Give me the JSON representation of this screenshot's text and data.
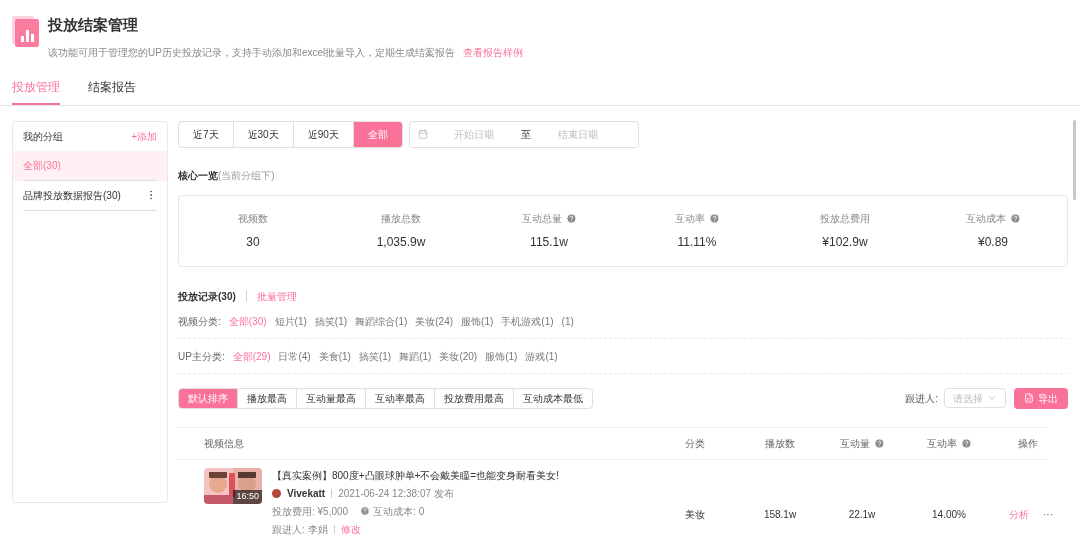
{
  "header": {
    "title": "投放结案管理",
    "description": "该功能可用于管理您的UP历史投放记录，支持手动添加和excel批量导入，定期生成结案报告",
    "link": "查看报告样例"
  },
  "tabs": [
    {
      "label": "投放管理",
      "selected": true
    },
    {
      "label": "结案报告",
      "selected": false
    }
  ],
  "sidebar": {
    "title": "我的分组",
    "add": "+添加",
    "groups": [
      {
        "label": "全部(30)",
        "selected": true,
        "has_menu": false
      },
      {
        "label": "品牌投放数据报告(30)",
        "selected": false,
        "has_menu": true
      }
    ]
  },
  "date_filter": {
    "ranges": [
      {
        "label": "近7天",
        "selected": false
      },
      {
        "label": "近30天",
        "selected": false
      },
      {
        "label": "近90天",
        "selected": false
      },
      {
        "label": "全部",
        "selected": true
      }
    ],
    "start_placeholder": "开始日期",
    "separator": "至",
    "end_placeholder": "结束日期"
  },
  "overview": {
    "title": "核心一览",
    "note": "(当前分组下)",
    "metrics": [
      {
        "label": "视频数",
        "value": "30",
        "help": false
      },
      {
        "label": "播放总数",
        "value": "1,035.9w",
        "help": false
      },
      {
        "label": "互动总量",
        "value": "115.1w",
        "help": true
      },
      {
        "label": "互动率",
        "value": "11.11%",
        "help": true
      },
      {
        "label": "投放总费用",
        "value": "¥102.9w",
        "help": false
      },
      {
        "label": "互动成本",
        "value": "¥0.89",
        "help": true
      }
    ]
  },
  "records": {
    "title": "投放记录(30)",
    "batch": "批量管理",
    "filters": [
      {
        "label": "视频分类:",
        "options": [
          {
            "label": "全部(30)",
            "selected": true
          },
          {
            "label": "短片(1)",
            "selected": false
          },
          {
            "label": "搞笑(1)",
            "selected": false
          },
          {
            "label": "舞蹈综合(1)",
            "selected": false
          },
          {
            "label": "美妆(24)",
            "selected": false
          },
          {
            "label": "服饰(1)",
            "selected": false
          },
          {
            "label": "手机游戏(1)",
            "selected": false
          },
          {
            "label": "(1)",
            "selected": false
          }
        ]
      },
      {
        "label": "UP主分类:",
        "options": [
          {
            "label": "全部(29)",
            "selected": true
          },
          {
            "label": "日常(4)",
            "selected": false
          },
          {
            "label": "美食(1)",
            "selected": false
          },
          {
            "label": "搞笑(1)",
            "selected": false
          },
          {
            "label": "舞蹈(1)",
            "selected": false
          },
          {
            "label": "美妆(20)",
            "selected": false
          },
          {
            "label": "服饰(1)",
            "selected": false
          },
          {
            "label": "游戏(1)",
            "selected": false
          }
        ]
      }
    ],
    "sorts": [
      {
        "label": "默认排序",
        "selected": true
      },
      {
        "label": "播放最高",
        "selected": false
      },
      {
        "label": "互动量最高",
        "selected": false
      },
      {
        "label": "互动率最高",
        "selected": false
      },
      {
        "label": "投放费用最高",
        "selected": false
      },
      {
        "label": "互动成本最低",
        "selected": false
      }
    ],
    "follower": {
      "label": "跟进人:",
      "placeholder": "请选择"
    },
    "export": "导出",
    "columns": [
      {
        "label": "视频信息",
        "help": false
      },
      {
        "label": "分类",
        "help": false
      },
      {
        "label": "播放数",
        "help": false
      },
      {
        "label": "互动量",
        "help": true
      },
      {
        "label": "互动率",
        "help": true
      },
      {
        "label": "操作",
        "help": false
      }
    ],
    "rows": [
      {
        "duration": "16:50",
        "title": "【真实案例】800度+凸眼球肿单+不会戴美瞳=也能变身耐看美女!",
        "author": "Vivekatt",
        "published": "2021-06-24 12:38:07 发布",
        "cost": "投放费用: ¥5,000",
        "interaction_cost": "互动成本: 0",
        "follower": "跟进人: 李娟",
        "edit": "修改",
        "category": "美妆",
        "plays": "158.1w",
        "interactions": "22.1w",
        "rate": "14.00%",
        "action": "分析",
        "more": "···"
      }
    ]
  }
}
